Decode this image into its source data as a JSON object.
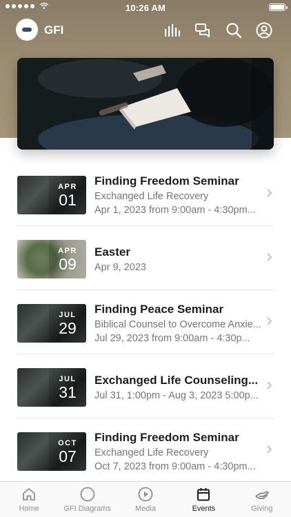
{
  "status_bar": {
    "time": "10:26 AM"
  },
  "header": {
    "app_title": "GFI"
  },
  "events": [
    {
      "month": "APR",
      "day": "01",
      "title": "Finding Freedom Seminar",
      "subtitle": "Exchanged Life Recovery",
      "date_line": "Apr 1, 2023 from 9:00am - 4:30pm...",
      "thumb": "dark"
    },
    {
      "month": "APR",
      "day": "09",
      "title": "Easter",
      "subtitle": "",
      "date_line": "Apr 9, 2023",
      "thumb": "green"
    },
    {
      "month": "JUL",
      "day": "29",
      "title": "Finding Peace Seminar",
      "subtitle": "Biblical Counsel to Overcome Anxie...",
      "date_line": "Jul 29, 2023 from 9:00am - 4:30p...",
      "thumb": "dark"
    },
    {
      "month": "JUL",
      "day": "31",
      "title": "Exchanged Life Counseling...",
      "subtitle": "",
      "date_line": "Jul 31, 1:00pm - Aug 3, 2023 5:00p...",
      "thumb": "dark"
    },
    {
      "month": "OCT",
      "day": "07",
      "title": "Finding Freedom Seminar",
      "subtitle": "Exchanged Life Recovery",
      "date_line": "Oct 7, 2023 from 9:00am - 4:30pm...",
      "thumb": "dark"
    }
  ],
  "tab_bar": {
    "tabs": [
      {
        "label": "Home",
        "icon": "home-icon"
      },
      {
        "label": "GFI Diagrams",
        "icon": "circle-icon"
      },
      {
        "label": "Media",
        "icon": "play-icon"
      },
      {
        "label": "Events",
        "icon": "calendar-icon"
      },
      {
        "label": "Giving",
        "icon": "giving-hand-icon"
      }
    ],
    "active": "Events"
  },
  "colors": {
    "header_bg": "#9c8c72",
    "accent_text": "#1d1d1f",
    "muted_text": "#757575"
  }
}
